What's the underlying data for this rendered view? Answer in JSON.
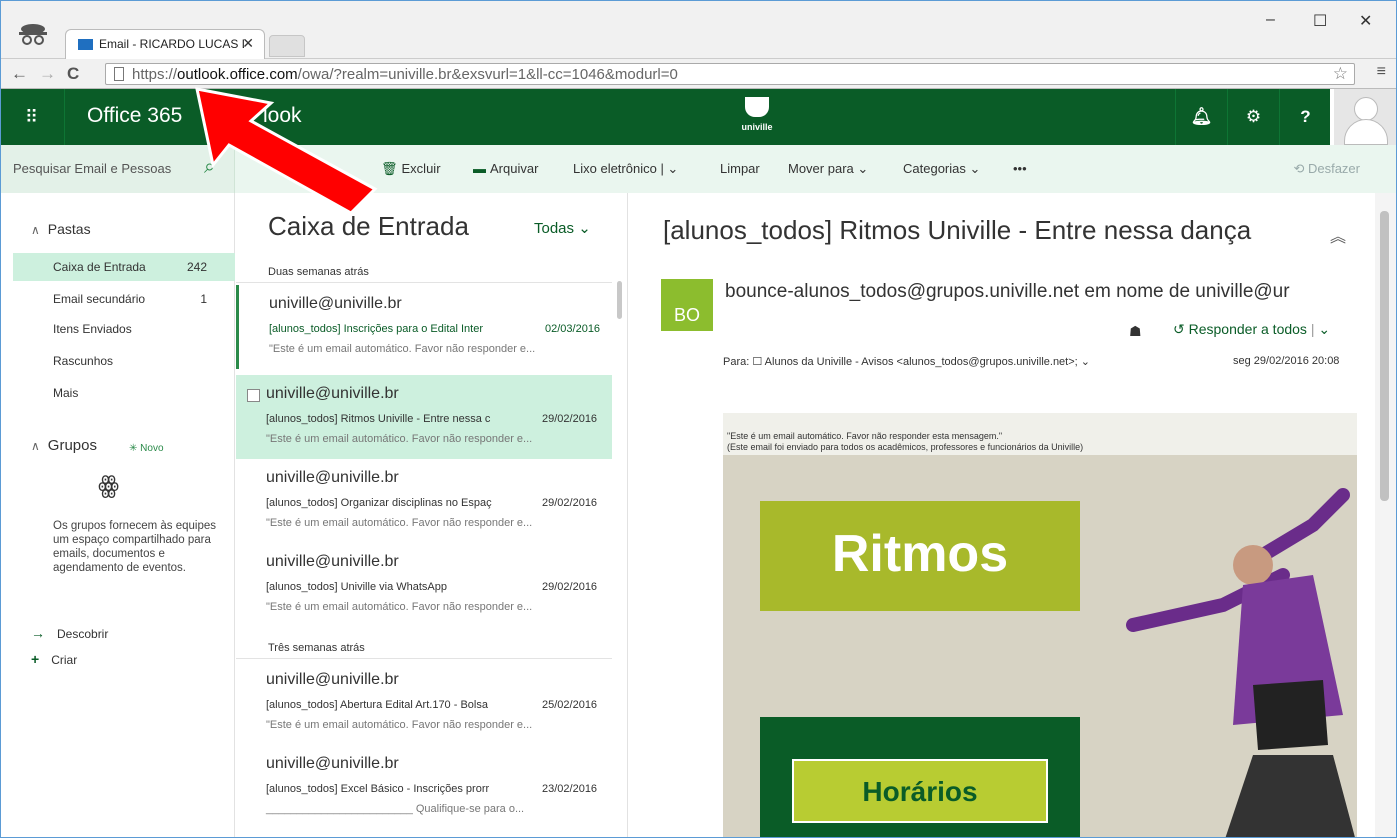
{
  "browser": {
    "tab_title": "Email - RICARDO LUCAS D",
    "url_prefix": "https://",
    "url_host": "outlook.office.com",
    "url_path": "/owa/?realm=univille.br&exsvurl=1&ll-cc=1046&modurl=0"
  },
  "header": {
    "suite": "Office 365",
    "app": "look",
    "logo_text": "univille"
  },
  "commands": {
    "search_placeholder": "Pesquisar Email e Pessoas",
    "delete": "Excluir",
    "archive": "Arquivar",
    "junk": "Lixo eletrônico",
    "clear": "Limpar",
    "move": "Mover para",
    "categories": "Categorias",
    "more": "•••",
    "undo": "Desfazer"
  },
  "nav": {
    "folders_header": "Pastas",
    "folders": [
      {
        "name": "Caixa de Entrada",
        "count": "242"
      },
      {
        "name": "Email secundário",
        "count": "1"
      },
      {
        "name": "Itens Enviados",
        "count": ""
      },
      {
        "name": "Rascunhos",
        "count": ""
      },
      {
        "name": "Mais",
        "count": ""
      }
    ],
    "groups_header": "Grupos",
    "groups_new": "Novo",
    "groups_desc": "Os grupos fornecem às equipes um espaço compartilhado para emails, documentos e agendamento de eventos.",
    "discover": "Descobrir",
    "create": "Criar"
  },
  "list": {
    "title": "Caixa de Entrada",
    "filter": "Todas",
    "group1": "Duas semanas atrás",
    "group2": "Três semanas atrás",
    "messages": [
      {
        "from": "univille@univille.br",
        "subject": "[alunos_todos] Inscrições para o Edital Inter",
        "date": "02/03/2016",
        "preview": "\"Este é um email automático. Favor não responder e..."
      },
      {
        "from": "univille@univille.br",
        "subject": "[alunos_todos] Ritmos Univille - Entre nessa c",
        "date": "29/02/2016",
        "preview": "\"Este é um email automático. Favor não responder e..."
      },
      {
        "from": "univille@univille.br",
        "subject": "[alunos_todos] Organizar disciplinas no Espaç",
        "date": "29/02/2016",
        "preview": "\"Este é um email automático. Favor não responder e..."
      },
      {
        "from": "univille@univille.br",
        "subject": "[alunos_todos] Univille via WhatsApp",
        "date": "29/02/2016",
        "preview": "\"Este é um email automático. Favor não responder e..."
      },
      {
        "from": "univille@univille.br",
        "subject": "[alunos_todos] Abertura Edital Art.170 - Bolsa",
        "date": "25/02/2016",
        "preview": "\"Este é um email automático. Favor não responder e..."
      },
      {
        "from": "univille@univille.br",
        "subject": "[alunos_todos] Excel Básico - Inscrições prorr",
        "date": "23/02/2016",
        "preview": "________________________ Qualifique-se para o..."
      }
    ]
  },
  "reading": {
    "subject": "[alunos_todos] Ritmos Univille - Entre nessa dança",
    "initials": "BO",
    "sender": "bounce-alunos_todos@grupos.univille.net em nome de univille@ur",
    "reply_all": "Responder a todos",
    "to_label": "Para:",
    "to": "Alunos da Univille - Avisos <alunos_todos@grupos.univille.net>;",
    "date": "seg 29/02/2016 20:08",
    "notice1": "\"Este é um email automático. Favor não responder esta mensagem.\"",
    "notice2": "(Este email foi enviado para todos os acadêmicos, professores e funcionários da Univille)",
    "poster_title": "Ritmos",
    "poster_hours": "Horários"
  },
  "colors": {
    "brand": "#0a5c27",
    "selection": "#cdf0de",
    "accent_green": "#a8b92b",
    "arrow": "#ff0000"
  }
}
